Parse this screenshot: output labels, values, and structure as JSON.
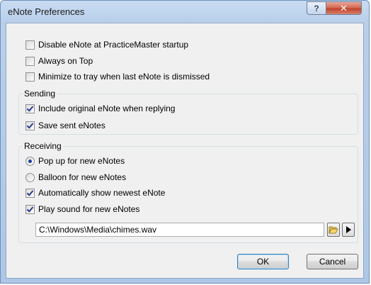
{
  "window": {
    "title": "eNote Preferences",
    "help_glyph": "?",
    "close_glyph": "✕"
  },
  "general": {
    "disable_startup": {
      "label": "Disable eNote at PracticeMaster startup",
      "checked": false
    },
    "always_on_top": {
      "label": "Always on Top",
      "checked": false
    },
    "minimize_to_tray": {
      "label": "Minimize to tray when last eNote is dismissed",
      "checked": false
    }
  },
  "sending": {
    "label": "Sending",
    "include_original": {
      "label": "Include original eNote when replying",
      "checked": true
    },
    "save_sent": {
      "label": "Save sent eNotes",
      "checked": true
    }
  },
  "receiving": {
    "label": "Receiving",
    "popup": {
      "label": "Pop up for new eNotes",
      "selected": true
    },
    "balloon": {
      "label": "Balloon for new eNotes",
      "selected": false
    },
    "auto_show_newest": {
      "label": "Automatically show newest eNote",
      "checked": true
    },
    "play_sound": {
      "label": "Play sound for new eNotes",
      "checked": true
    },
    "sound_path": "C:\\Windows\\Media\\chimes.wav"
  },
  "buttons": {
    "ok": "OK",
    "cancel": "Cancel"
  },
  "icons": {
    "browse": "folder-open-icon",
    "play": "play-icon"
  },
  "colors": {
    "check_mark": "#2a3b8f",
    "close_button": "#c0432c"
  }
}
